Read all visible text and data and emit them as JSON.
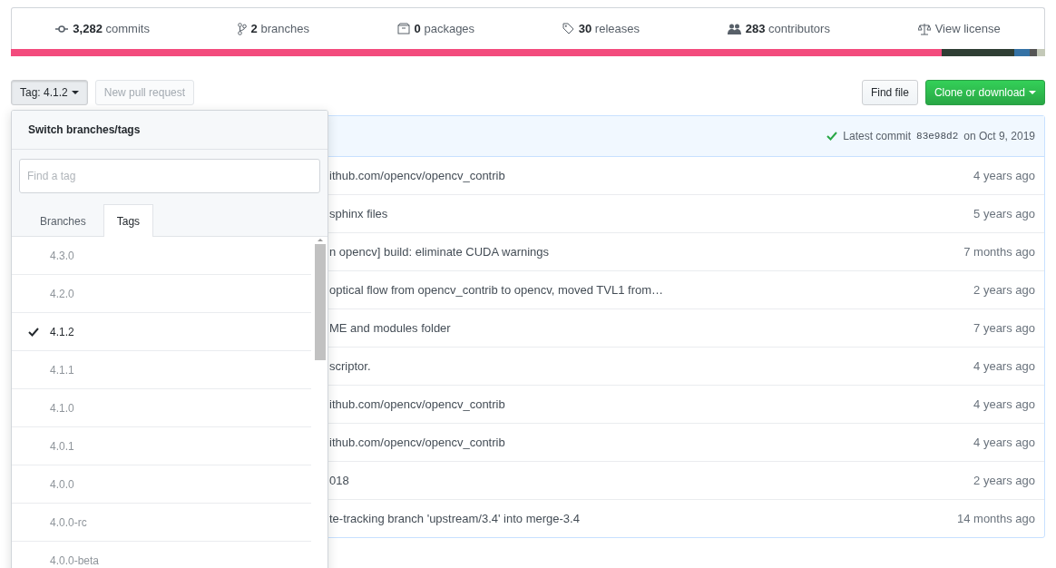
{
  "stats": [
    {
      "kind": "commits",
      "text": "**3,282** commits"
    },
    {
      "kind": "branches",
      "text": "**2** branches"
    },
    {
      "kind": "packages",
      "text": "**0** packages"
    },
    {
      "kind": "releases",
      "text": "**30** releases"
    },
    {
      "kind": "contributors",
      "text": "**283** contributors"
    },
    {
      "kind": "license",
      "text": "View license"
    }
  ],
  "languages": [
    {
      "color": "#f34b7d"
    },
    {
      "color": "#2f3e34"
    },
    {
      "color": "#3572a5"
    },
    {
      "color": "#555555"
    },
    {
      "color": "#c4c9b8"
    }
  ],
  "toolbar": {
    "tag_button": "Tag: 4.1.2",
    "pull_request": {
      "label": "New pull request",
      "disabled": true
    },
    "find_file": "Find file",
    "clone": "Clone or download"
  },
  "commit_bar": {
    "text": "Latest commit",
    "sha": "83e98d2",
    "date": "on Oct 9, 2019"
  },
  "rows": [
    {
      "message": "ithub.com/opencv/opencv_contrib",
      "age": "4 years ago"
    },
    {
      "message": "sphinx files",
      "age": "5 years ago"
    },
    {
      "message": "n opencv] build: eliminate CUDA warnings",
      "age": "7 months ago"
    },
    {
      "message": "optical flow from opencv_contrib to opencv, moved TVL1 from…",
      "age": "2 years ago"
    },
    {
      "message": "ME and modules folder",
      "age": "7 years ago"
    },
    {
      "message": "scriptor.",
      "age": "4 years ago"
    },
    {
      "message": "ithub.com/opencv/opencv_contrib",
      "age": "4 years ago"
    },
    {
      "message": "ithub.com/opencv/opencv_contrib",
      "age": "4 years ago"
    },
    {
      "message": "018",
      "age": "2 years ago"
    },
    {
      "message": "te-tracking branch 'upstream/3.4' into merge-3.4",
      "age": "14 months ago"
    }
  ],
  "dropdown": {
    "title": "Switch branches/tags",
    "filter": {
      "placeholder": "Find a tag"
    },
    "tabs": [
      {
        "label": "Branches",
        "selected": false
      },
      {
        "label": "Tags",
        "selected": true
      }
    ],
    "items": [
      {
        "label": "4.3.0",
        "selected": false
      },
      {
        "label": "4.2.0",
        "selected": false
      },
      {
        "label": "4.1.2",
        "selected": true
      },
      {
        "label": "4.1.1",
        "selected": false
      },
      {
        "label": "4.1.0",
        "selected": false
      },
      {
        "label": "4.0.1",
        "selected": false
      },
      {
        "label": "4.0.0",
        "selected": false
      },
      {
        "label": "4.0.0-rc",
        "selected": false
      },
      {
        "label": "4.0.0-beta",
        "selected": false
      }
    ]
  }
}
